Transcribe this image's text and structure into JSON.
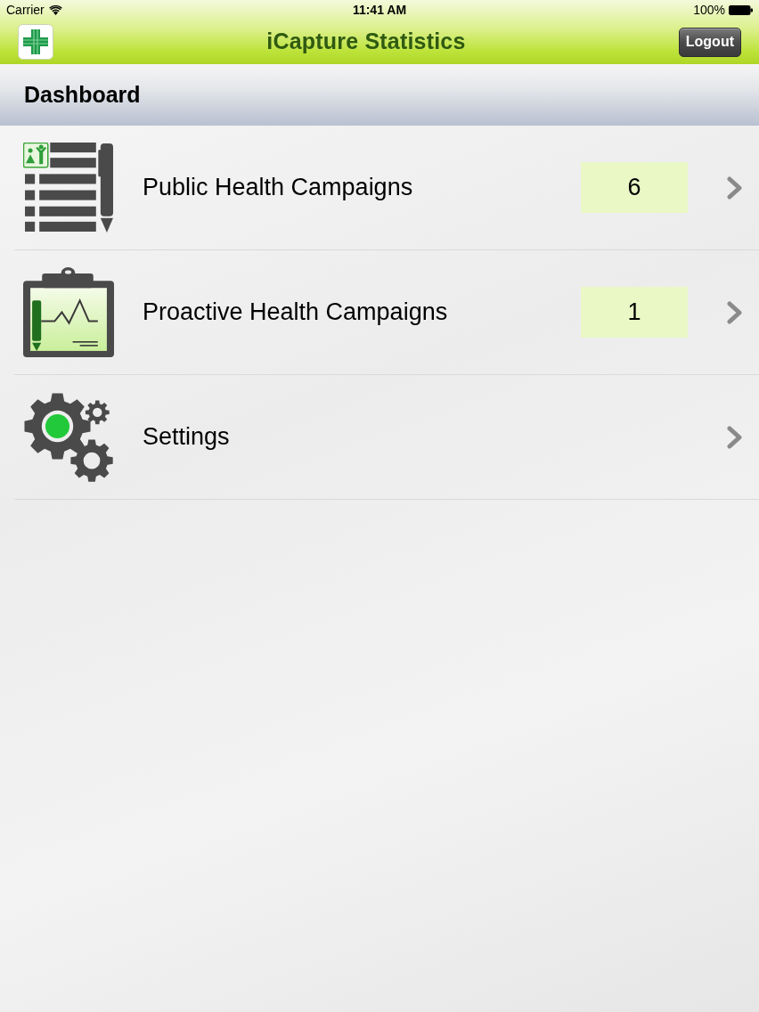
{
  "status_bar": {
    "carrier": "Carrier",
    "time": "11:41 AM",
    "battery": "100%"
  },
  "nav_bar": {
    "title": "iCapture Statistics",
    "logout_button": "Logout"
  },
  "section_header": {
    "title": "Dashboard"
  },
  "menu_items": [
    {
      "kind": "checklist",
      "label": "Public Health Campaigns",
      "count": "6"
    },
    {
      "kind": "clipboard",
      "label": "Proactive Health Campaigns",
      "count": "1"
    },
    {
      "kind": "gears",
      "label": "Settings"
    }
  ]
}
